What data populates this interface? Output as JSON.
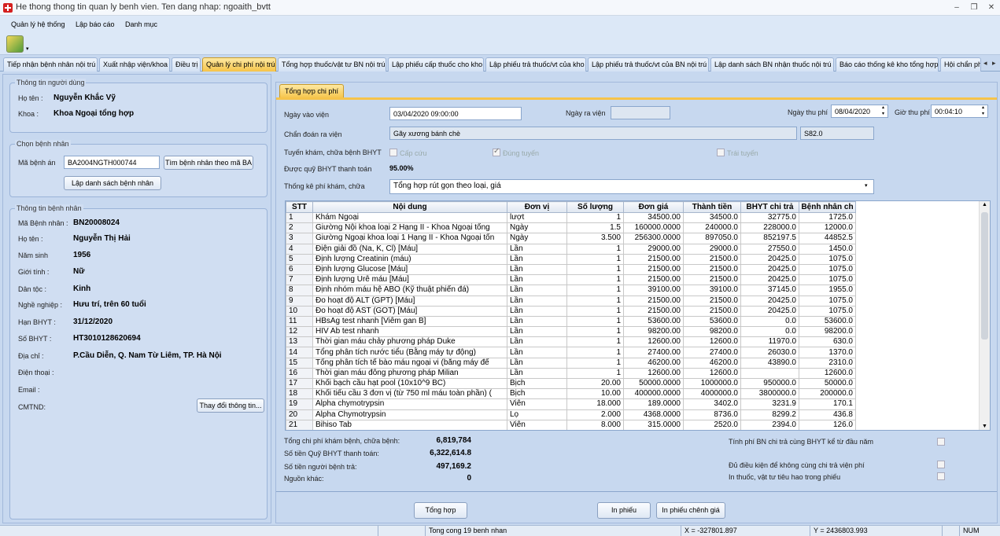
{
  "window": {
    "title": "He thong thong tin quan ly benh vien. Ten dang nhap: ngoaith_bvtt",
    "minimize": "–",
    "restore": "❐",
    "close": "✕"
  },
  "menu": [
    "Quản lý hệ thống",
    "Lập báo cáo",
    "Danh mục"
  ],
  "tabs": [
    "Tiếp nhận bệnh nhân nội trú",
    "Xuất nhập viện/khoa",
    "Điều trị",
    "Quản lý chi phí nội trú",
    "Tổng hợp thuốc/vật tư BN nội trú",
    "Lập phiếu cấp thuốc cho kho",
    "Lập phiếu trả thuốc/vt của kho",
    "Lập phiếu trả thuốc/vt của BN nội trú",
    "Lập danh sách BN nhận thuốc nội trú",
    "Báo cáo thống kê kho tổng hợp",
    "Hội chẩn phẫ"
  ],
  "user": {
    "group": "Thông tin người dùng",
    "name_label": "Họ tên :",
    "name": "Nguyễn Khắc Vỹ",
    "dept_label": "Khoa :",
    "dept": "Khoa Ngoại tổng hợp"
  },
  "choose": {
    "group": "Chọn bệnh nhân",
    "record_label": "Mã bệnh án",
    "record_value": "BA2004NGTH000744",
    "search_btn": "Tìm bệnh nhân theo mã BA",
    "list_btn": "Lập danh sách bệnh nhân"
  },
  "patient": {
    "group": "Thông tin bệnh nhân",
    "fields": [
      {
        "label": "Mã Bệnh nhân :",
        "value": "BN20008024"
      },
      {
        "label": "Họ tên :",
        "value": "Nguyễn Thị Hải"
      },
      {
        "label": "Năm sinh",
        "value": "1956"
      },
      {
        "label": "Giới tính :",
        "value": "Nữ"
      },
      {
        "label": "Dân tộc :",
        "value": "Kinh"
      },
      {
        "label": "Nghề nghiệp :",
        "value": "Hưu trí, trên 60 tuổi"
      },
      {
        "label": "Hạn BHYT :",
        "value": "31/12/2020"
      },
      {
        "label": "Số BHYT :",
        "value": "HT3010128620694"
      },
      {
        "label": "Địa chỉ :",
        "value": "P.Cầu Diễn, Q. Nam Từ Liêm, TP. Hà Nội"
      },
      {
        "label": "Điện thoại :",
        "value": ""
      },
      {
        "label": "Email :",
        "value": ""
      },
      {
        "label": "CMTND:",
        "value": ""
      }
    ],
    "change_btn": "Thay đổi thông tin..."
  },
  "cost": {
    "tab": "Tổng hợp chi phí",
    "admit_label": "Ngày vào viện",
    "admit_value": "03/04/2020 09:00:00",
    "discharge_label": "Ngày ra viện",
    "paydate_label": "Ngày thu phí",
    "paydate_value": "08/04/2020",
    "paytime_label": "Giờ thu phí",
    "paytime_value": "00:04:10",
    "diag_label": "Chẩn đoán ra viện",
    "diag_value": "Gãy xương bánh chè",
    "diag_code": "S82.0",
    "route_label": "Tuyến khám, chữa bệnh BHYT",
    "route_emergency": "Cấp cứu",
    "route_correct": "Đúng tuyến",
    "route_wrong": "Trái tuyến",
    "fund_label": "Được quỹ BHYT thanh toán",
    "fund_value": "95.00%",
    "stat_label": "Thống kê phí khám, chữa",
    "stat_value": "Tổng hợp rút gọn theo loại, giá"
  },
  "table": {
    "headers": [
      "STT",
      "Nội dung",
      "Đơn vị",
      "Số lượng",
      "Đơn giá",
      "Thành tiền",
      "BHYT chi trả",
      "Bệnh nhân ch"
    ],
    "rows": [
      [
        "1",
        "Khám Ngoại",
        "lượt",
        "1",
        "34500.00",
        "34500.0",
        "32775.0",
        "1725.0"
      ],
      [
        "2",
        "Giường Nội khoa loại 2 Hạng II - Khoa Ngoại tổng",
        "Ngày",
        "1.5",
        "160000.0000",
        "240000.0",
        "228000.0",
        "12000.0"
      ],
      [
        "3",
        "Giường Ngoại khoa loại 1 Hạng II - Khoa Ngoại tổn",
        "Ngày",
        "3.500",
        "256300.0000",
        "897050.0",
        "852197.5",
        "44852.5"
      ],
      [
        "4",
        "Điện giải đồ (Na, K, Cl) [Máu]",
        "Lần",
        "1",
        "29000.00",
        "29000.0",
        "27550.0",
        "1450.0"
      ],
      [
        "5",
        "Định lượng Creatinin (máu)",
        "Lần",
        "1",
        "21500.00",
        "21500.0",
        "20425.0",
        "1075.0"
      ],
      [
        "6",
        "Định lượng Glucose [Máu]",
        "Lần",
        "1",
        "21500.00",
        "21500.0",
        "20425.0",
        "1075.0"
      ],
      [
        "7",
        "Định lượng Urê máu [Máu]",
        "Lần",
        "1",
        "21500.00",
        "21500.0",
        "20425.0",
        "1075.0"
      ],
      [
        "8",
        "Định nhóm máu hệ ABO (Kỹ thuật phiến đá)",
        "Lần",
        "1",
        "39100.00",
        "39100.0",
        "37145.0",
        "1955.0"
      ],
      [
        "9",
        "Đo hoạt độ ALT (GPT) [Máu]",
        "Lần",
        "1",
        "21500.00",
        "21500.0",
        "20425.0",
        "1075.0"
      ],
      [
        "10",
        "Đo hoạt độ AST (GOT) [Máu]",
        "Lần",
        "1",
        "21500.00",
        "21500.0",
        "20425.0",
        "1075.0"
      ],
      [
        "11",
        "HBsAg test nhanh [Viêm gan B]",
        "Lần",
        "1",
        "53600.00",
        "53600.0",
        "0.0",
        "53600.0"
      ],
      [
        "12",
        "HIV Ab test nhanh",
        "Lần",
        "1",
        "98200.00",
        "98200.0",
        "0.0",
        "98200.0"
      ],
      [
        "13",
        "Thời gian máu chảy phương pháp Duke",
        "Lần",
        "1",
        "12600.00",
        "12600.0",
        "11970.0",
        "630.0"
      ],
      [
        "14",
        "Tổng phân tích nước tiểu (Bằng máy tự động)",
        "Lần",
        "1",
        "27400.00",
        "27400.0",
        "26030.0",
        "1370.0"
      ],
      [
        "15",
        "Tổng phân tích tế bào máu ngoại vi (bằng máy đế",
        "Lần",
        "1",
        "46200.00",
        "46200.0",
        "43890.0",
        "2310.0"
      ],
      [
        "16",
        "Thời gian máu đông phương pháp Milian",
        "Lần",
        "1",
        "12600.00",
        "12600.0",
        "",
        "12600.0"
      ],
      [
        "17",
        "Khối bạch cầu hạt pool (10x10^9 BC)",
        "Bịch",
        "20.00",
        "50000.0000",
        "1000000.0",
        "950000.0",
        "50000.0"
      ],
      [
        "18",
        "Khối tiểu cầu 3 đơn vị (từ 750 ml máu toàn phần) (",
        "Bịch",
        "10.00",
        "400000.0000",
        "4000000.0",
        "3800000.0",
        "200000.0"
      ],
      [
        "19",
        "Alpha chymotrypsin",
        "Viên",
        "18.000",
        "189.0000",
        "3402.0",
        "3231.9",
        "170.1"
      ],
      [
        "20",
        "Alpha Chymotrypsin",
        "Lọ",
        "2.000",
        "4368.0000",
        "8736.0",
        "8299.2",
        "436.8"
      ],
      [
        "21",
        "Bihiso Tab",
        "Viên",
        "8.000",
        "315.0000",
        "2520.0",
        "2394.0",
        "126.0"
      ]
    ]
  },
  "summary": {
    "total_label": "Tổng chi phí khám bệnh, chữa bệnh:",
    "total_value": "6,819,784",
    "fund_label": "Số tiền Quỹ BHYT thanh toán:",
    "fund_value": "6,322,614.8",
    "patient_label": "Số tiền người bệnh trả:",
    "patient_value": "497,169.2",
    "other_label": "Nguồn khác:",
    "other_value": "0",
    "opt1": "Tính phí BN chi trả cùng BHYT kể từ đầu năm",
    "opt2": "Đủ điều kiện để không cùng chi trả viện phí",
    "opt3": "In thuốc, vật tư tiêu hao trong phiếu"
  },
  "buttons": {
    "total": "Tổng hợp",
    "print": "In phiếu",
    "print_diff": "In phiếu chênh giá"
  },
  "status": {
    "count": "Tong cong 19 benh nhan",
    "x": "X = -327801.897",
    "y": "Y = 2436803.993",
    "num": "NUM"
  }
}
